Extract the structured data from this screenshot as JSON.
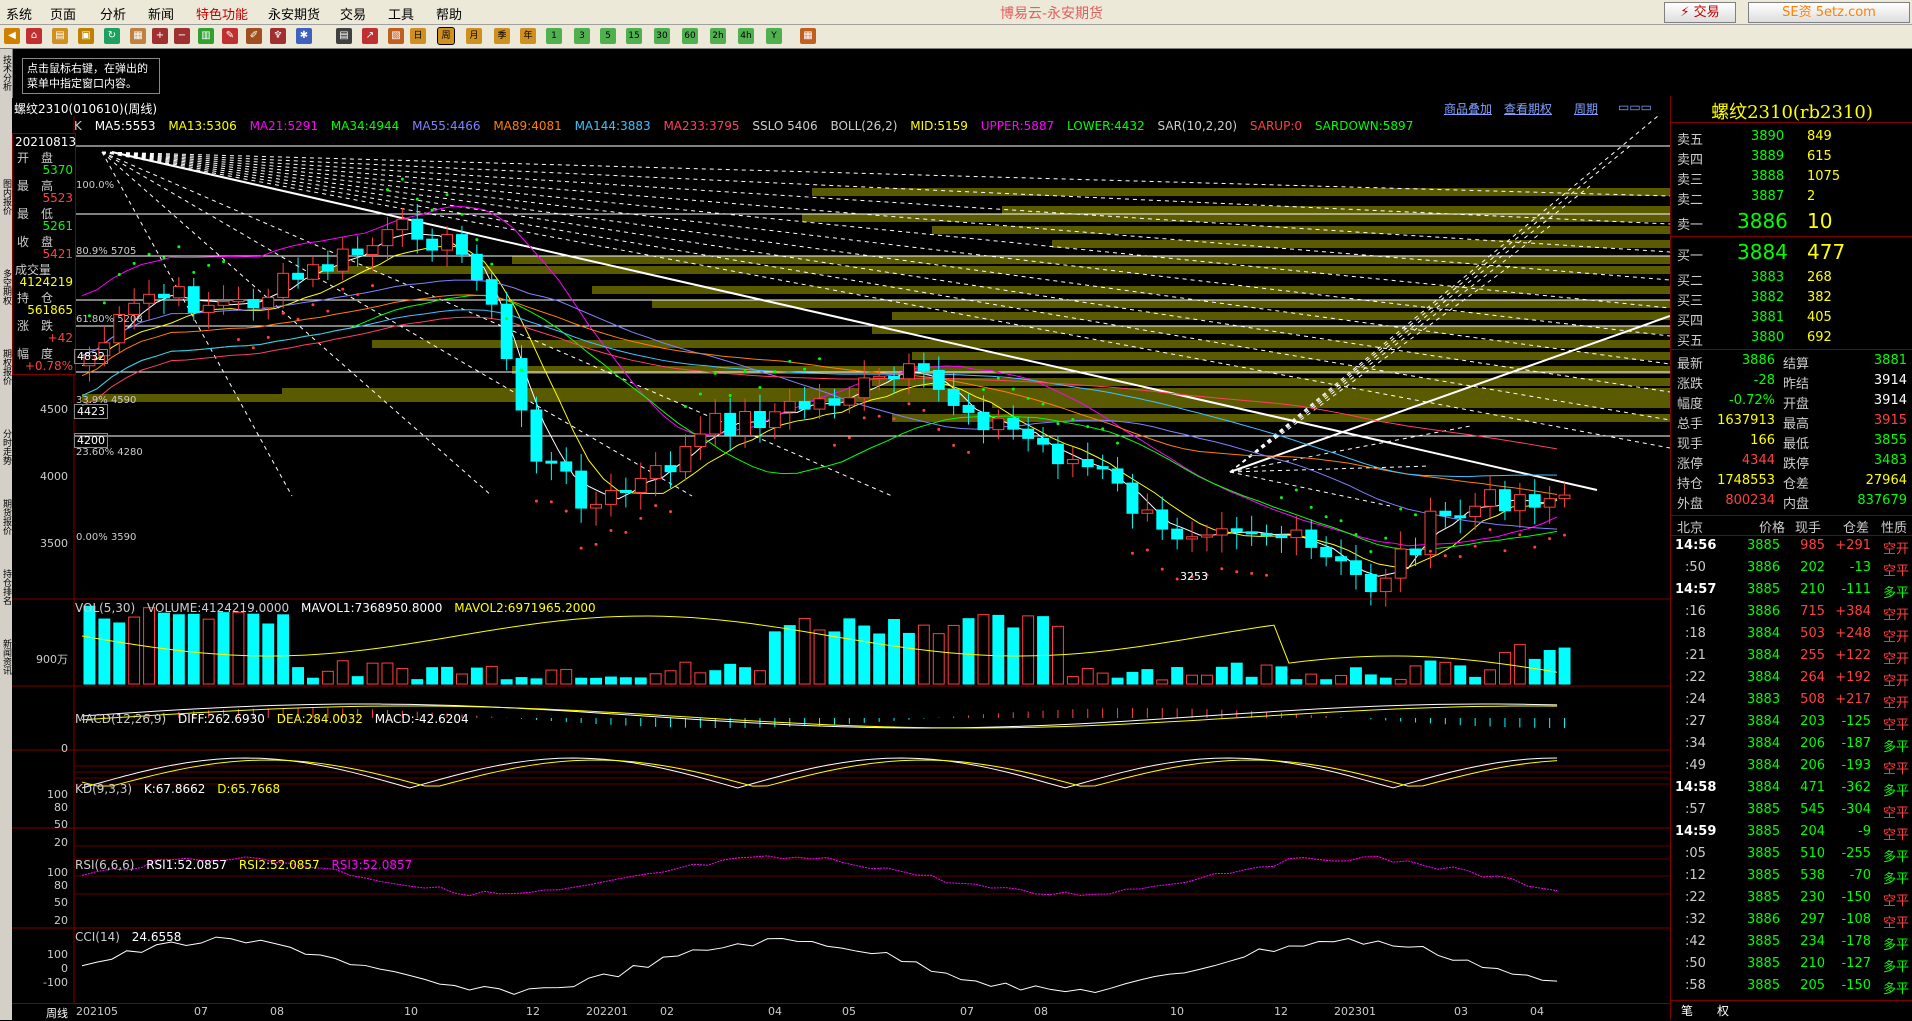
{
  "menu": {
    "items": [
      "系统",
      "页面",
      "分析",
      "新闻",
      "特色功能",
      "永安期货",
      "交易",
      "工具",
      "帮助"
    ],
    "highlight_index": 4,
    "app_title": "博易云-永安期货",
    "trade_button": "交易",
    "info_button": "资讯",
    "watermark": "SE资 5etz.com"
  },
  "toolbar": {
    "period_buttons": [
      "日",
      "周",
      "月",
      "季",
      "年",
      "1",
      "3",
      "5",
      "15",
      "30",
      "60",
      "2h",
      "4h",
      "Y"
    ]
  },
  "left_tabs": [
    "技术分析",
    "图内报价",
    "多空期权",
    "期权报价",
    "分时走势",
    "期货报价",
    "持仓排名",
    "新闻资讯"
  ],
  "tip": "点击鼠标右键，在弹出的菜单中指定窗口内容。",
  "chart_header": {
    "title": "螺纹2310(010610)(周线)",
    "links": [
      "商品叠加",
      "查看期权",
      "周期"
    ]
  },
  "ma_line": [
    {
      "text": "K",
      "color": "#cccccc"
    },
    {
      "text": "MA5:5553",
      "color": "#ffffff"
    },
    {
      "text": "MA13:5306",
      "color": "#ffff00"
    },
    {
      "text": "MA21:5291",
      "color": "#ff00ff"
    },
    {
      "text": "MA34:4944",
      "color": "#00ff00"
    },
    {
      "text": "MA55:4466",
      "color": "#8080ff"
    },
    {
      "text": "MA89:4081",
      "color": "#ff8000"
    },
    {
      "text": "MA144:3883",
      "color": "#40c0ff"
    },
    {
      "text": "MA233:3795",
      "color": "#ff4060"
    },
    {
      "text": "SSLO 5406",
      "color": "#cccccc"
    },
    {
      "text": "BOLL(26,2)",
      "color": "#cccccc"
    },
    {
      "text": "MID:5159",
      "color": "#ffff00"
    },
    {
      "text": "UPPER:5887",
      "color": "#ff00ff"
    },
    {
      "text": "LOWER:4432",
      "color": "#00ff00"
    },
    {
      "text": "SAR(10,2,20)",
      "color": "#cccccc"
    },
    {
      "text": "SARUP:0",
      "color": "#ff4040"
    },
    {
      "text": "SARDOWN:5897",
      "color": "#00ff00"
    }
  ],
  "info_panel": {
    "date": "20210813",
    "open_label": "开　盘",
    "open": "5370",
    "high_label": "最　高",
    "high": "5523",
    "low_label": "最　低",
    "low": "5261",
    "close_label": "收　盘",
    "close": "5421",
    "volume_label": "成交量",
    "volume": "4124219",
    "oi_label": "持　仓",
    "oi": "561865",
    "change_label": "涨　跌",
    "change": "+42",
    "pct_label": "幅　度",
    "pct": "+0.78%"
  },
  "main_chart": {
    "y_ticks": [
      "4500",
      "4000",
      "3500"
    ],
    "price_tags": [
      "4832",
      "4423",
      "4200"
    ],
    "fib_labels": [
      "100.0%",
      "80.9% 5705",
      "61.80% 5208",
      "4832",
      "33.9% 4590",
      "23.60% 4280",
      "0.00% 3590"
    ],
    "low_label": "3253"
  },
  "volume_panel": {
    "header": [
      {
        "text": "VOL(5,30)",
        "color": "#cccccc"
      },
      {
        "text": "VOLUME:4124219.0000",
        "color": "#cccccc"
      },
      {
        "text": "MAVOL1:7368950.8000",
        "color": "#ffffff"
      },
      {
        "text": "MAVOL2:6971965.2000",
        "color": "#ffff00"
      }
    ],
    "y_label": "900万"
  },
  "macd_panel": {
    "header": [
      {
        "text": "MACD(12,26,9)",
        "color": "#cccccc"
      },
      {
        "text": "DIFF:262.6930",
        "color": "#ffffff"
      },
      {
        "text": "DEA:284.0032",
        "color": "#ffff00"
      },
      {
        "text": "MACD:-42.6204",
        "color": "#ffffff"
      }
    ],
    "y_label": "0"
  },
  "kd_panel": {
    "header": [
      {
        "text": "KD(9,3,3)",
        "color": "#cccccc"
      },
      {
        "text": "K:67.8662",
        "color": "#ffffff"
      },
      {
        "text": "D:65.7668",
        "color": "#ffff00"
      }
    ],
    "y_labels": [
      "100",
      "80",
      "50",
      "20"
    ]
  },
  "rsi_panel": {
    "header": [
      {
        "text": "RSI(6,6,6)",
        "color": "#cccccc"
      },
      {
        "text": "RSI1:52.0857",
        "color": "#ffffff"
      },
      {
        "text": "RSI2:52.0857",
        "color": "#ffff00"
      },
      {
        "text": "RSI3:52.0857",
        "color": "#ff00ff"
      }
    ],
    "y_labels": [
      "100",
      "80",
      "50",
      "20"
    ]
  },
  "cci_panel": {
    "header": [
      {
        "text": "CCI(14)",
        "color": "#cccccc"
      },
      {
        "text": "24.6558",
        "color": "#ffffff"
      }
    ],
    "y_labels": [
      "100",
      "0",
      "-100"
    ]
  },
  "x_axis": {
    "period_label": "周线",
    "labels": [
      "202105",
      "07",
      "08",
      "10",
      "12",
      "202201",
      "02",
      "04",
      "05",
      "07",
      "08",
      "10",
      "12",
      "202301",
      "03",
      "04"
    ]
  },
  "right_panel": {
    "title": "螺纹2310(rb2310)",
    "asks": [
      {
        "label": "卖五",
        "price": "3890",
        "vol": "849"
      },
      {
        "label": "卖四",
        "price": "3889",
        "vol": "615"
      },
      {
        "label": "卖三",
        "price": "3888",
        "vol": "1075"
      },
      {
        "label": "卖二",
        "price": "3887",
        "vol": "2"
      },
      {
        "label": "卖一",
        "price": "3886",
        "vol": "10"
      }
    ],
    "bids": [
      {
        "label": "买一",
        "price": "3884",
        "vol": "477"
      },
      {
        "label": "买二",
        "price": "3883",
        "vol": "268"
      },
      {
        "label": "买三",
        "price": "3882",
        "vol": "382"
      },
      {
        "label": "买四",
        "price": "3881",
        "vol": "405"
      },
      {
        "label": "买五",
        "price": "3880",
        "vol": "692"
      }
    ],
    "stats": [
      {
        "l1": "最新",
        "v1": "3886",
        "c1": "#00ff00",
        "l2": "结算",
        "v2": "3881",
        "c2": "#00ff00"
      },
      {
        "l1": "涨跌",
        "v1": "-28",
        "c1": "#00ff00",
        "l2": "昨结",
        "v2": "3914",
        "c2": "#ffffff"
      },
      {
        "l1": "幅度",
        "v1": "-0.72%",
        "c1": "#00ff00",
        "l2": "开盘",
        "v2": "3914",
        "c2": "#ffffff"
      },
      {
        "l1": "总手",
        "v1": "1637913",
        "c1": "#ffff00",
        "l2": "最高",
        "v2": "3915",
        "c2": "#ff4040"
      },
      {
        "l1": "现手",
        "v1": "166",
        "c1": "#ffff00",
        "l2": "最低",
        "v2": "3855",
        "c2": "#00ff00"
      },
      {
        "l1": "涨停",
        "v1": "4344",
        "c1": "#ff4040",
        "l2": "跌停",
        "v2": "3483",
        "c2": "#00ff00"
      },
      {
        "l1": "持仓",
        "v1": "1748553",
        "c1": "#ffff00",
        "l2": "仓差",
        "v2": "27964",
        "c2": "#ffff00"
      },
      {
        "l1": "外盘",
        "v1": "800234",
        "c1": "#ff4040",
        "l2": "内盘",
        "v2": "837679",
        "c2": "#00ff00"
      }
    ],
    "tick_header": [
      "北京",
      "价格",
      "现手",
      "仓差",
      "性质"
    ],
    "ticks": [
      {
        "t": "14:56",
        "p": "3885",
        "v": "985",
        "d": "+291",
        "n": "空开",
        "big": true
      },
      {
        "t": ":50",
        "p": "3886",
        "v": "202",
        "d": "-13",
        "n": "空平",
        "big": false
      },
      {
        "t": "14:57",
        "p": "3885",
        "v": "210",
        "d": "-111",
        "n": "多平",
        "big": true
      },
      {
        "t": ":16",
        "p": "3886",
        "v": "715",
        "d": "+384",
        "n": "空开",
        "big": false
      },
      {
        "t": ":18",
        "p": "3884",
        "v": "503",
        "d": "+248",
        "n": "空开",
        "big": false
      },
      {
        "t": ":21",
        "p": "3884",
        "v": "255",
        "d": "+122",
        "n": "空开",
        "big": false
      },
      {
        "t": ":22",
        "p": "3884",
        "v": "264",
        "d": "+192",
        "n": "空开",
        "big": false
      },
      {
        "t": ":24",
        "p": "3883",
        "v": "508",
        "d": "+217",
        "n": "空开",
        "big": false
      },
      {
        "t": ":27",
        "p": "3884",
        "v": "203",
        "d": "-125",
        "n": "空平",
        "big": false
      },
      {
        "t": ":34",
        "p": "3884",
        "v": "206",
        "d": "-187",
        "n": "多平",
        "big": false
      },
      {
        "t": ":49",
        "p": "3884",
        "v": "206",
        "d": "-193",
        "n": "空平",
        "big": false
      },
      {
        "t": "14:58",
        "p": "3884",
        "v": "471",
        "d": "-362",
        "n": "多平",
        "big": true
      },
      {
        "t": ":57",
        "p": "3885",
        "v": "545",
        "d": "-304",
        "n": "空平",
        "big": false
      },
      {
        "t": "14:59",
        "p": "3885",
        "v": "204",
        "d": "-9",
        "n": "空平",
        "big": true
      },
      {
        "t": ":05",
        "p": "3885",
        "v": "510",
        "d": "-255",
        "n": "多平",
        "big": false
      },
      {
        "t": ":12",
        "p": "3885",
        "v": "538",
        "d": "-70",
        "n": "多平",
        "big": false
      },
      {
        "t": ":22",
        "p": "3885",
        "v": "230",
        "d": "-150",
        "n": "空平",
        "big": false
      },
      {
        "t": ":32",
        "p": "3886",
        "v": "297",
        "d": "-108",
        "n": "空平",
        "big": false
      },
      {
        "t": ":42",
        "p": "3885",
        "v": "234",
        "d": "-178",
        "n": "多平",
        "big": false
      },
      {
        "t": ":50",
        "p": "3885",
        "v": "210",
        "d": "-127",
        "n": "多平",
        "big": false
      },
      {
        "t": ":58",
        "p": "3885",
        "v": "205",
        "d": "-150",
        "n": "多平",
        "big": false
      }
    ],
    "bottom_tabs": [
      "笔",
      "权"
    ]
  }
}
